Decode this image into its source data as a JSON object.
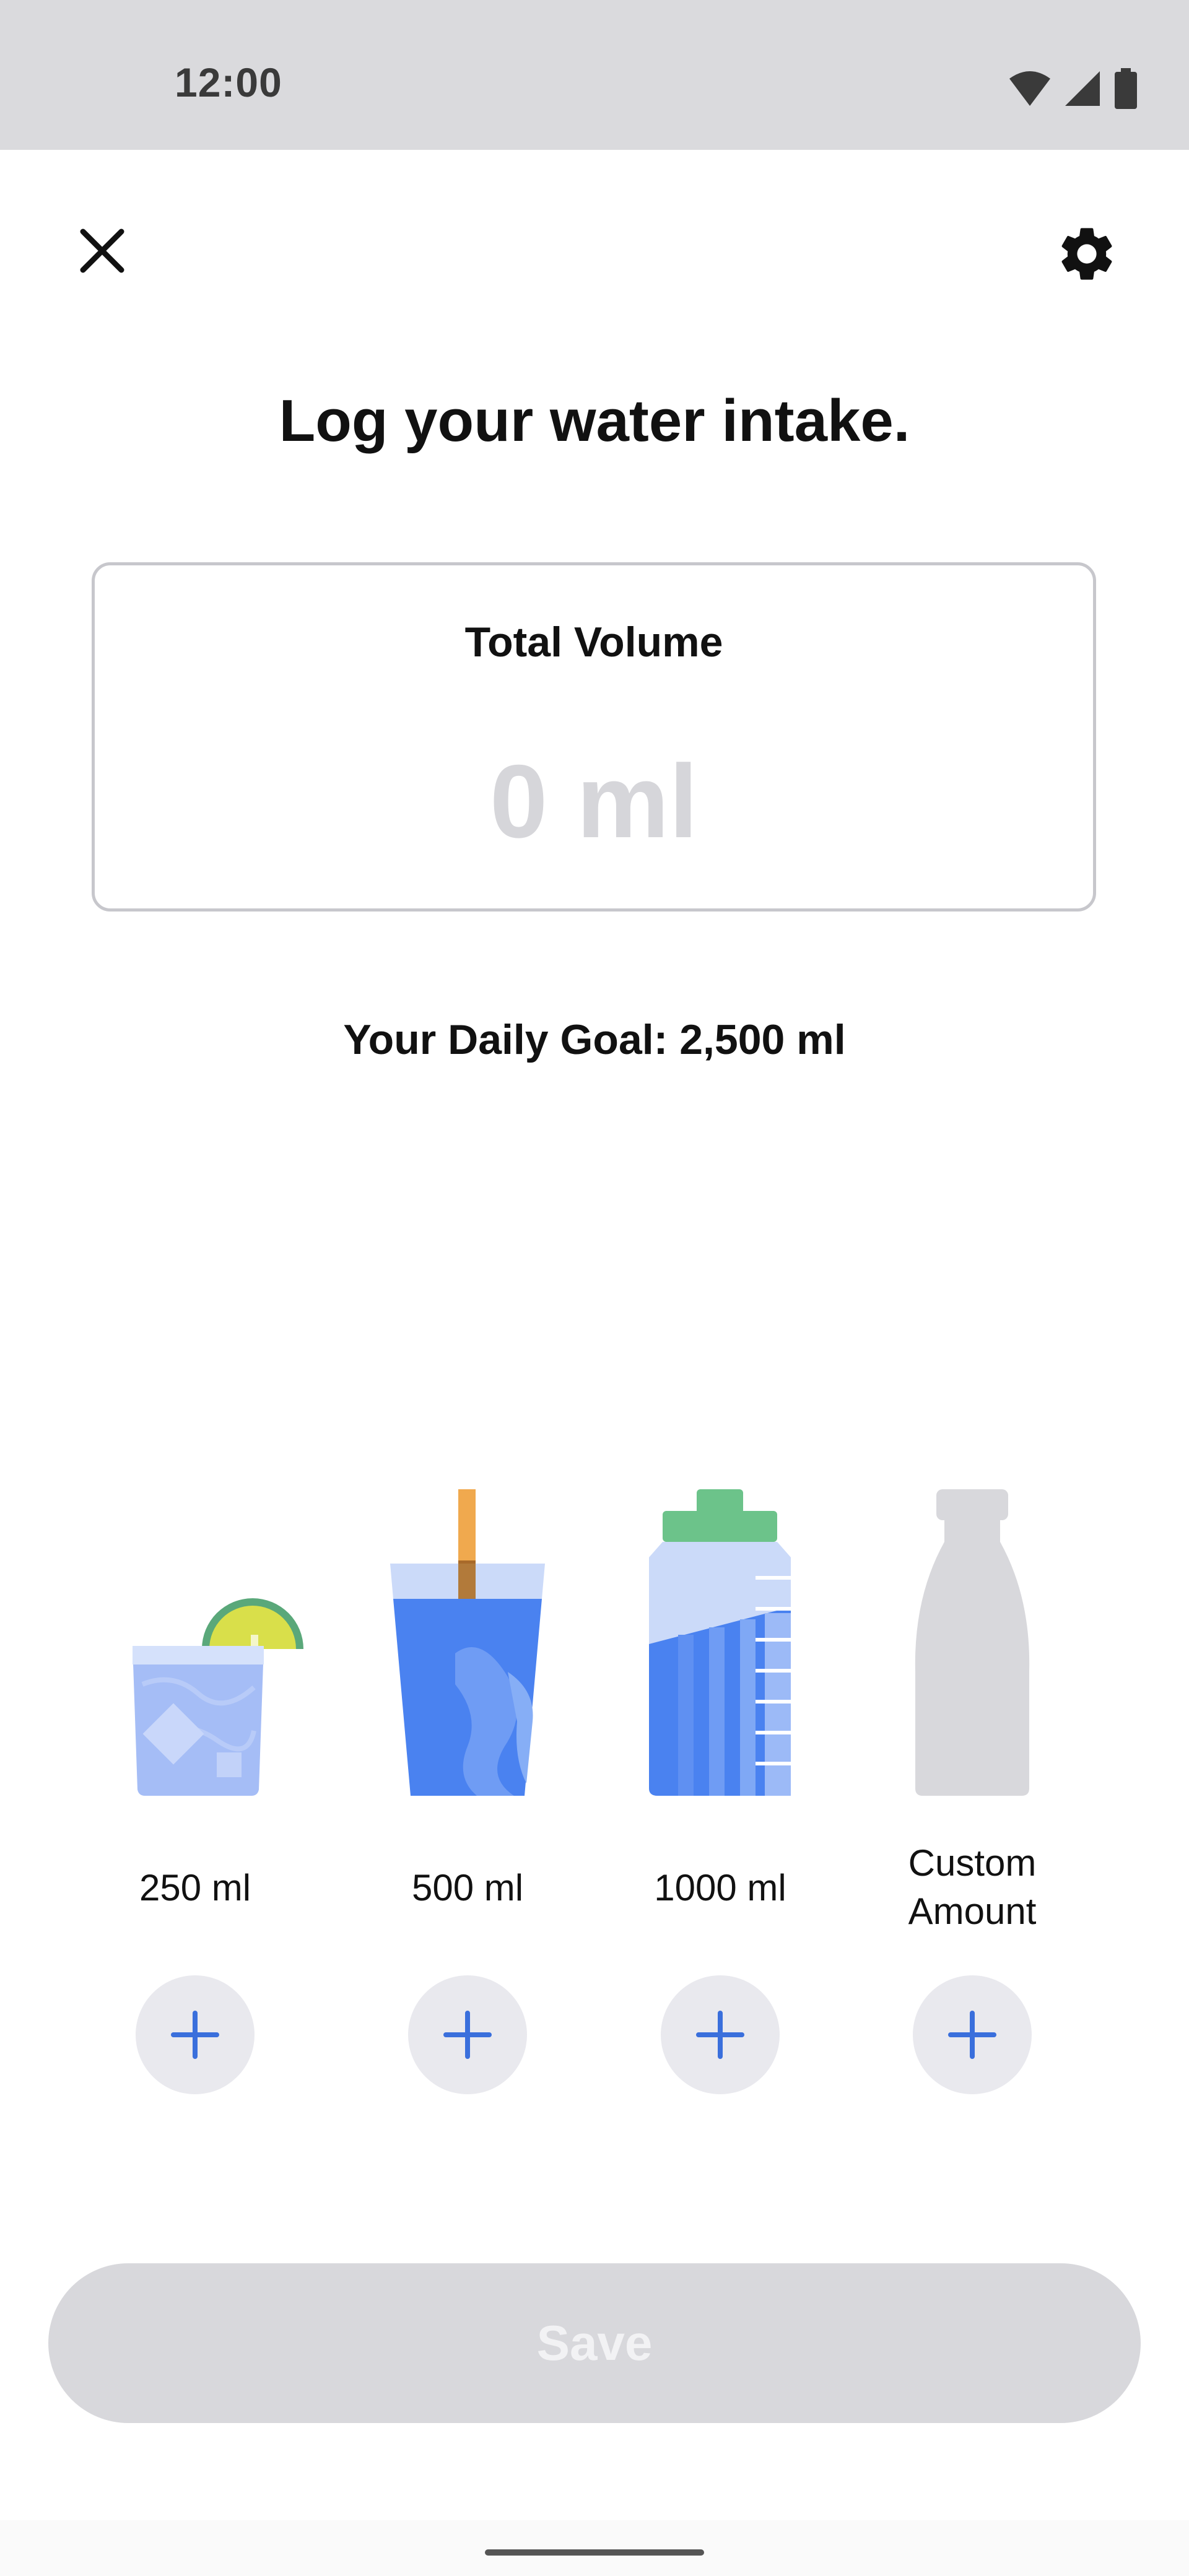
{
  "status_bar": {
    "time": "12:00",
    "icons": [
      "wifi-icon",
      "signal-icon",
      "battery-icon"
    ]
  },
  "header": {
    "close_icon": "close-icon",
    "settings_icon": "gear-icon"
  },
  "title": "Log your water intake.",
  "volume_card": {
    "label": "Total Volume",
    "value": "0 ml"
  },
  "daily_goal": "Your Daily Goal: 2,500 ml",
  "drinks": [
    {
      "label": "250 ml",
      "graphic": "glass-with-lime"
    },
    {
      "label": "500 ml",
      "graphic": "cup-with-straw"
    },
    {
      "label": "1000 ml",
      "graphic": "sport-bottle"
    },
    {
      "label": "Custom\nAmount",
      "graphic": "empty-bottle"
    }
  ],
  "add_icon": "plus-icon",
  "save_button": {
    "label": "Save",
    "enabled": false
  },
  "colors": {
    "accent_blue": "#3a6fdc",
    "disabled_gray": "#d8d8dc",
    "water_light": "#9cb8f4",
    "water_dark": "#4a82f0",
    "lime": "#d9df4a",
    "bottle_cap_green": "#6cc38a",
    "straw_orange": "#f0a94e"
  }
}
